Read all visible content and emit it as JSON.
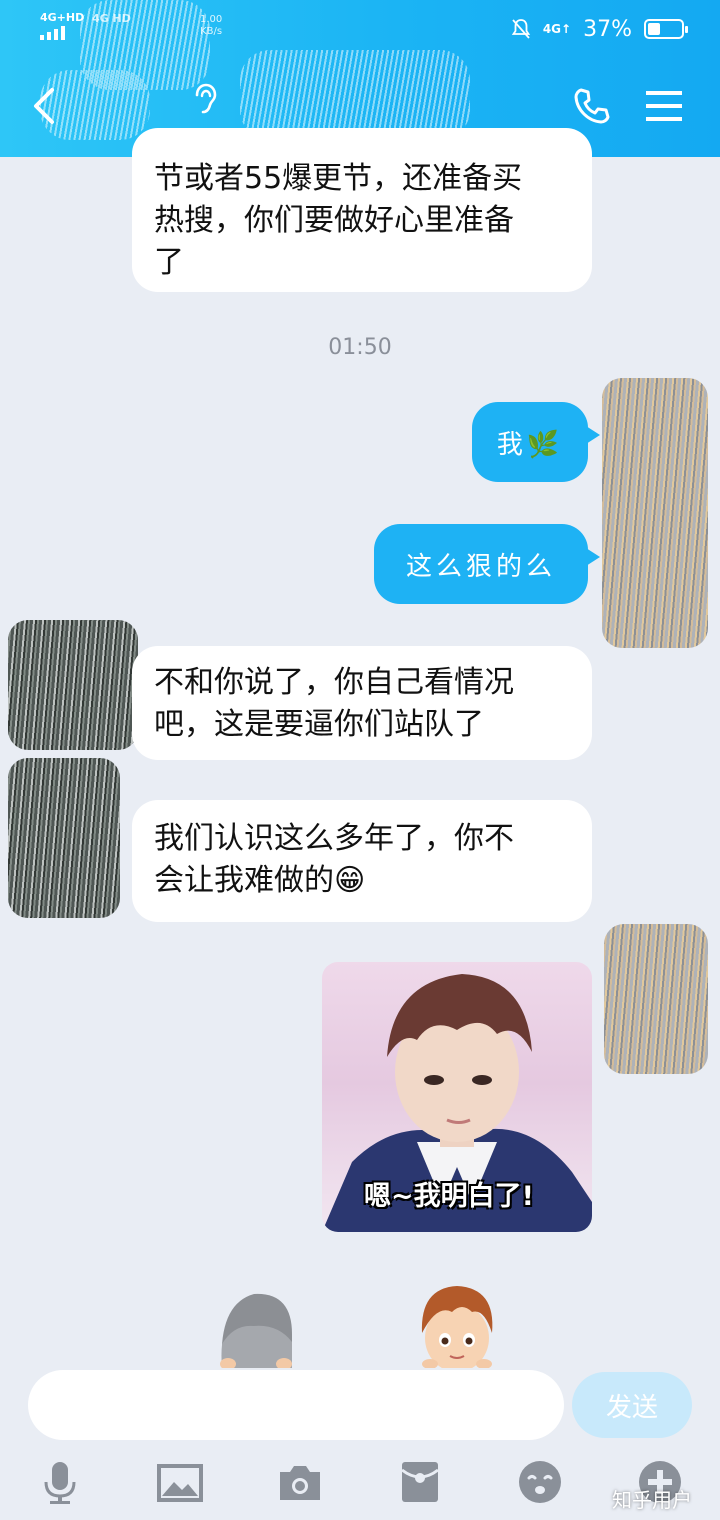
{
  "status_bar": {
    "network_left": "4G+HD",
    "network_left2": "4G HD",
    "speed_value": "1.00",
    "speed_unit": "KB/s",
    "network_right": "4G↑",
    "battery": "37%",
    "battery_level": 0.37
  },
  "header": {
    "back_icon": "chevron-left-icon",
    "ear_icon": "ear-icon",
    "call_icon": "phone-icon",
    "menu_icon": "menu-icon"
  },
  "messages": [
    {
      "side": "in",
      "text_lines": [
        "节或者55爆更节，还准备买",
        "热搜，你们要做好心里准备",
        "了"
      ]
    },
    {
      "side": "time",
      "text": "01:50"
    },
    {
      "side": "out",
      "text": "我🌿"
    },
    {
      "side": "out",
      "text": "这么狠的么"
    },
    {
      "side": "in",
      "text_lines": [
        "不和你说了，你自己看情况",
        "吧，这是要逼你们站队了"
      ]
    },
    {
      "side": "in",
      "text_lines": [
        "我们认识这么多年了，你不",
        "会让我难做的😁"
      ]
    },
    {
      "side": "out",
      "type": "image",
      "caption": "嗯~我明白了!"
    }
  ],
  "input": {
    "placeholder": "",
    "send_label": "发送"
  },
  "toolbar": {
    "items": [
      "microphone-icon",
      "image-icon",
      "camera-icon",
      "red-packet-icon",
      "emoji-icon",
      "plus-icon"
    ]
  },
  "watermark": "知乎用户",
  "colors": {
    "header": "#1bb4f4",
    "outgoing_bubble": "#1eb2f4",
    "background": "#e9edf4",
    "send_button": "#c8e9fb"
  }
}
